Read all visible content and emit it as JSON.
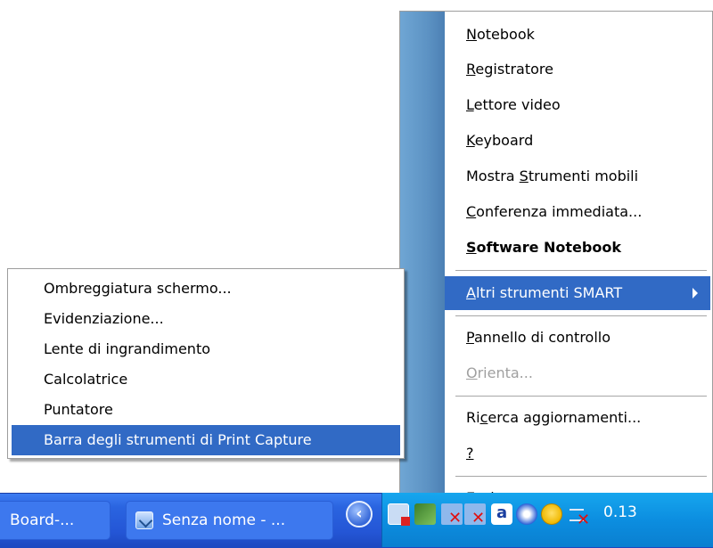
{
  "main_menu": {
    "items": [
      {
        "pre": "",
        "key": "N",
        "post": "otebook",
        "style": "normal"
      },
      {
        "pre": "",
        "key": "R",
        "post": "egistratore",
        "style": "normal"
      },
      {
        "pre": "",
        "key": "L",
        "post": "ettore video",
        "style": "normal"
      },
      {
        "pre": "",
        "key": "K",
        "post": "eyboard",
        "style": "normal"
      },
      {
        "pre": "Mostra ",
        "key": "S",
        "post": "trumenti mobili",
        "style": "normal"
      },
      {
        "pre": "",
        "key": "C",
        "post": "onferenza immediata...",
        "style": "normal"
      },
      {
        "pre": "",
        "key": "S",
        "post": "oftware Notebook",
        "style": "bold"
      },
      {
        "pre": "",
        "key": "A",
        "post": "ltri strumenti SMART",
        "style": "highlight"
      },
      {
        "pre": "",
        "key": "P",
        "post": "annello di controllo",
        "style": "normal"
      },
      {
        "pre": "",
        "key": "O",
        "post": "rienta...",
        "style": "disabled"
      },
      {
        "pre": "Ri",
        "key": "c",
        "post": "erca aggiornamenti...",
        "style": "normal"
      },
      {
        "pre": "",
        "key": "?",
        "post": "",
        "style": "normal"
      },
      {
        "pre": "",
        "key": "E",
        "post": "sci",
        "style": "normal"
      }
    ]
  },
  "sub_menu": {
    "items": [
      "Ombreggiatura schermo...",
      "Evidenziazione...",
      "Lente di ingrandimento",
      "Calcolatrice",
      "Puntatore",
      "Barra degli strumenti di Print Capture"
    ],
    "highlighted_index": 5
  },
  "taskbar": {
    "buttons": [
      {
        "label": "Board-..."
      },
      {
        "label": "Senza nome - ..."
      }
    ],
    "tray_expand_glyph": "‹",
    "clock": "0.13",
    "tray_icons": [
      "network-disabled-icon",
      "smart-board-icon",
      "network-x-icon",
      "network-x-icon",
      "adobe-icon",
      "info-icon",
      "smiley-icon",
      "connection-x-icon"
    ]
  },
  "colors": {
    "menu_highlight": "#316ac5",
    "taskbar_blue": "#2456d6",
    "tray_blue": "#0c8ee0"
  }
}
